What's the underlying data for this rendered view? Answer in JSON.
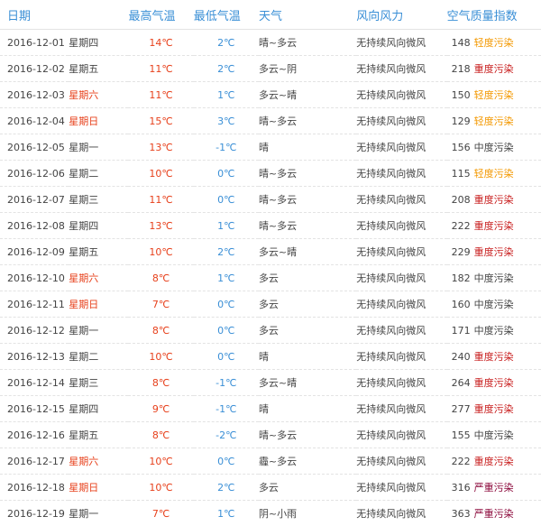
{
  "headers": {
    "date": "日期",
    "weekday": "",
    "high": "最高气温",
    "low": "最低气温",
    "weather": "天气",
    "wind": "风向风力",
    "aqi": "空气质量指数"
  },
  "colors": {
    "header": "#3a8fd6",
    "high_temp": "#e7401b",
    "low_temp": "#3a8fd6",
    "weekend": "#e7401b",
    "aqi_light": "#f39800",
    "aqi_medium": "#e7401b",
    "aqi_heavy": "#c81e1e",
    "aqi_severe": "#8c0a3c"
  },
  "rows": [
    {
      "date": "2016-12-01",
      "weekday": "星期四",
      "weekend": false,
      "high": "14℃",
      "low": "2℃",
      "weather": "晴~多云",
      "wind": "无持续风向微风",
      "aqi": "148",
      "quality": "轻度污染",
      "level": "light"
    },
    {
      "date": "2016-12-02",
      "weekday": "星期五",
      "weekend": false,
      "high": "11℃",
      "low": "2℃",
      "weather": "多云~阴",
      "wind": "无持续风向微风",
      "aqi": "218",
      "quality": "重度污染",
      "level": "heavy"
    },
    {
      "date": "2016-12-03",
      "weekday": "星期六",
      "weekend": true,
      "high": "11℃",
      "low": "1℃",
      "weather": "多云~晴",
      "wind": "无持续风向微风",
      "aqi": "150",
      "quality": "轻度污染",
      "level": "light"
    },
    {
      "date": "2016-12-04",
      "weekday": "星期日",
      "weekend": true,
      "high": "15℃",
      "low": "3℃",
      "weather": "晴~多云",
      "wind": "无持续风向微风",
      "aqi": "129",
      "quality": "轻度污染",
      "level": "light"
    },
    {
      "date": "2016-12-05",
      "weekday": "星期一",
      "weekend": false,
      "high": "13℃",
      "low": "-1℃",
      "weather": "晴",
      "wind": "无持续风向微风",
      "aqi": "156",
      "quality": "中度污染",
      "level": "medium"
    },
    {
      "date": "2016-12-06",
      "weekday": "星期二",
      "weekend": false,
      "high": "10℃",
      "low": "0℃",
      "weather": "晴~多云",
      "wind": "无持续风向微风",
      "aqi": "115",
      "quality": "轻度污染",
      "level": "light"
    },
    {
      "date": "2016-12-07",
      "weekday": "星期三",
      "weekend": false,
      "high": "11℃",
      "low": "0℃",
      "weather": "晴~多云",
      "wind": "无持续风向微风",
      "aqi": "208",
      "quality": "重度污染",
      "level": "heavy"
    },
    {
      "date": "2016-12-08",
      "weekday": "星期四",
      "weekend": false,
      "high": "13℃",
      "low": "1℃",
      "weather": "晴~多云",
      "wind": "无持续风向微风",
      "aqi": "222",
      "quality": "重度污染",
      "level": "heavy"
    },
    {
      "date": "2016-12-09",
      "weekday": "星期五",
      "weekend": false,
      "high": "10℃",
      "low": "2℃",
      "weather": "多云~晴",
      "wind": "无持续风向微风",
      "aqi": "229",
      "quality": "重度污染",
      "level": "heavy"
    },
    {
      "date": "2016-12-10",
      "weekday": "星期六",
      "weekend": true,
      "high": "8℃",
      "low": "1℃",
      "weather": "多云",
      "wind": "无持续风向微风",
      "aqi": "182",
      "quality": "中度污染",
      "level": "medium"
    },
    {
      "date": "2016-12-11",
      "weekday": "星期日",
      "weekend": true,
      "high": "7℃",
      "low": "0℃",
      "weather": "多云",
      "wind": "无持续风向微风",
      "aqi": "160",
      "quality": "中度污染",
      "level": "medium"
    },
    {
      "date": "2016-12-12",
      "weekday": "星期一",
      "weekend": false,
      "high": "8℃",
      "low": "0℃",
      "weather": "多云",
      "wind": "无持续风向微风",
      "aqi": "171",
      "quality": "中度污染",
      "level": "medium"
    },
    {
      "date": "2016-12-13",
      "weekday": "星期二",
      "weekend": false,
      "high": "10℃",
      "low": "0℃",
      "weather": "晴",
      "wind": "无持续风向微风",
      "aqi": "240",
      "quality": "重度污染",
      "level": "heavy"
    },
    {
      "date": "2016-12-14",
      "weekday": "星期三",
      "weekend": false,
      "high": "8℃",
      "low": "-1℃",
      "weather": "多云~晴",
      "wind": "无持续风向微风",
      "aqi": "264",
      "quality": "重度污染",
      "level": "heavy"
    },
    {
      "date": "2016-12-15",
      "weekday": "星期四",
      "weekend": false,
      "high": "9℃",
      "low": "-1℃",
      "weather": "晴",
      "wind": "无持续风向微风",
      "aqi": "277",
      "quality": "重度污染",
      "level": "heavy"
    },
    {
      "date": "2016-12-16",
      "weekday": "星期五",
      "weekend": false,
      "high": "8℃",
      "low": "-2℃",
      "weather": "晴~多云",
      "wind": "无持续风向微风",
      "aqi": "155",
      "quality": "中度污染",
      "level": "medium"
    },
    {
      "date": "2016-12-17",
      "weekday": "星期六",
      "weekend": true,
      "high": "10℃",
      "low": "0℃",
      "weather": "霾~多云",
      "wind": "无持续风向微风",
      "aqi": "222",
      "quality": "重度污染",
      "level": "heavy"
    },
    {
      "date": "2016-12-18",
      "weekday": "星期日",
      "weekend": true,
      "high": "10℃",
      "low": "2℃",
      "weather": "多云",
      "wind": "无持续风向微风",
      "aqi": "316",
      "quality": "严重污染",
      "level": "severe"
    },
    {
      "date": "2016-12-19",
      "weekday": "星期一",
      "weekend": false,
      "high": "7℃",
      "low": "1℃",
      "weather": "阴~小雨",
      "wind": "无持续风向微风",
      "aqi": "363",
      "quality": "严重污染",
      "level": "severe"
    }
  ]
}
